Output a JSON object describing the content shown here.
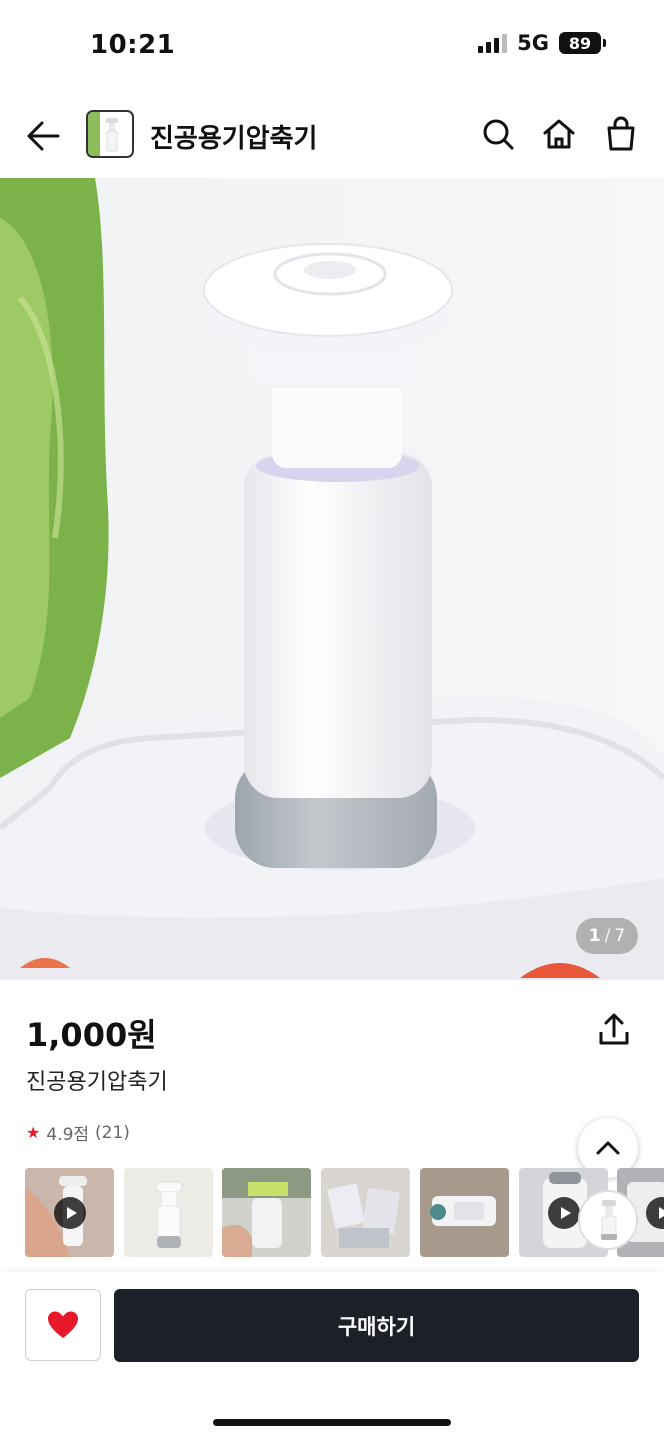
{
  "status_bar": {
    "time": "10:21",
    "network": "5G",
    "battery": "89"
  },
  "header": {
    "title": "진공용기압축기"
  },
  "hero": {
    "page_current": "1",
    "page_separator": "/",
    "page_total": "7"
  },
  "product": {
    "price": "1,000원",
    "name": "진공용기압축기",
    "rating": "4.9점",
    "review_count": "(21)"
  },
  "thumbnails": [
    "video",
    "image",
    "image",
    "image",
    "image",
    "video",
    "video"
  ],
  "bottom_bar": {
    "buy_label": "구매하기"
  },
  "colors": {
    "accent_red": "#e8192c",
    "buy_button": "#1c2028"
  }
}
